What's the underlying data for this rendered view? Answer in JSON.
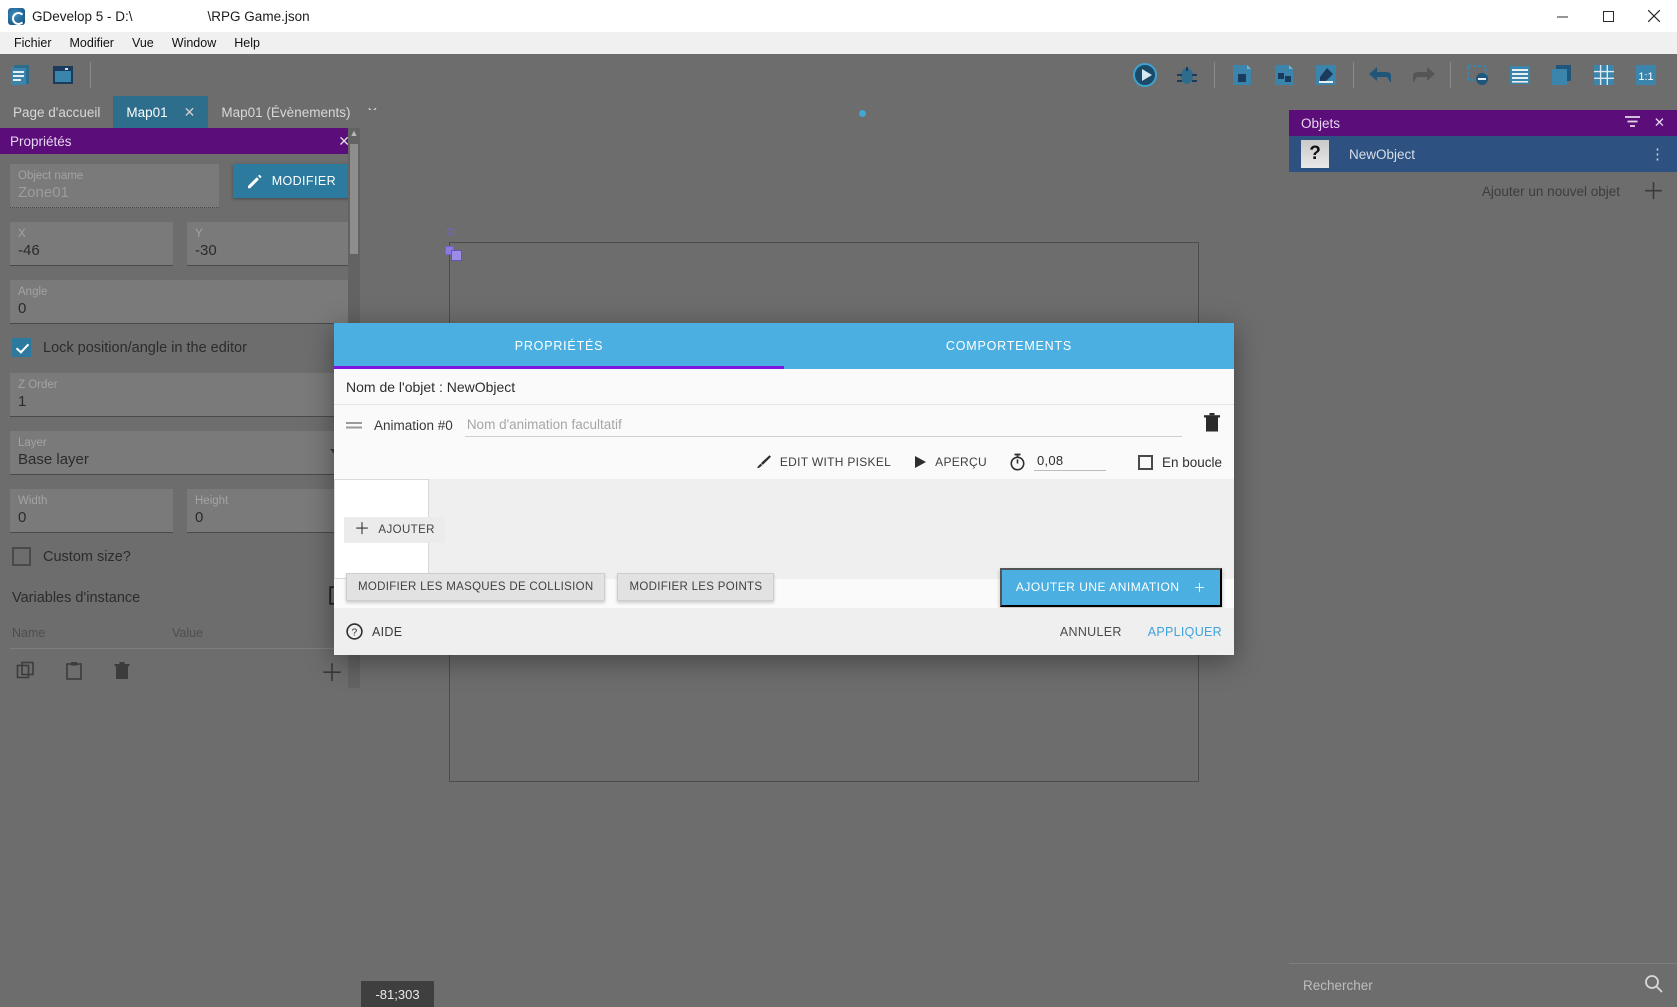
{
  "window": {
    "title": "GDevelop 5 - D:\\                    \\RPG Game.json",
    "minimize": "minimize-icon",
    "maximize": "maximize-icon",
    "close": "close-icon"
  },
  "menubar": {
    "items": [
      {
        "label": "Fichier"
      },
      {
        "label": "Modifier"
      },
      {
        "label": "Vue"
      },
      {
        "label": "Window"
      },
      {
        "label": "Help"
      }
    ]
  },
  "toolbar": {
    "left_icons": [
      "project-manager-icon",
      "scene-editor-icon"
    ],
    "right_icons": [
      "preview-play-icon",
      "debug-bug-icon",
      "new-scene-icon",
      "new-external-layout-icon",
      "open-editor-icon",
      "undo-icon",
      "redo-icon",
      "delete-selection-icon",
      "list-view-icon",
      "layers-icon",
      "grid-icon",
      "zoom-reset-icon"
    ]
  },
  "tabs": [
    {
      "label": "Page d'accueil",
      "active": false,
      "closable": false
    },
    {
      "label": "Map01",
      "active": true,
      "closable": true
    },
    {
      "label": "Map01 (Évènements)",
      "active": false,
      "closable": true
    }
  ],
  "properties_panel": {
    "title": "Propriétés",
    "close_icon": "close-icon",
    "object_name": {
      "label": "Object name",
      "value": "Zone01"
    },
    "modify_button": {
      "label": "MODIFIER",
      "icon": "pencil-icon"
    },
    "x": {
      "label": "X",
      "value": "-46"
    },
    "y": {
      "label": "Y",
      "value": "-30"
    },
    "angle": {
      "label": "Angle",
      "value": "0"
    },
    "lock": {
      "label": "Lock position/angle in the editor",
      "checked": true
    },
    "z_order": {
      "label": "Z Order",
      "value": "1"
    },
    "layer": {
      "label": "Layer",
      "value": "Base layer",
      "icon": "chevron-down-icon"
    },
    "width": {
      "label": "Width",
      "value": "0"
    },
    "height": {
      "label": "Height",
      "value": "0"
    },
    "custom_size": {
      "label": "Custom size?",
      "checked": false
    },
    "variables": {
      "title": "Variables d'instance",
      "open_icon": "external-link-icon",
      "columns": [
        "Name",
        "Value"
      ],
      "toolbar_icons": [
        "copy-icon",
        "paste-icon",
        "trash-icon",
        "add-icon"
      ]
    }
  },
  "canvas": {
    "coordinates": "-81;303"
  },
  "objects_panel": {
    "title": "Objets",
    "filter_icon": "filter-icon",
    "close_icon": "close-icon",
    "items": [
      {
        "name": "NewObject",
        "thumb": "question-mark-icon",
        "menu_icon": "more-vert-icon"
      }
    ],
    "add_label": "Ajouter un nouvel objet",
    "add_icon": "plus-icon",
    "search_placeholder": "Rechercher",
    "search_value": "",
    "search_icon": "search-icon"
  },
  "dialog": {
    "tabs": [
      {
        "label": "PROPRIÉTÉS",
        "active": true
      },
      {
        "label": "COMPORTEMENTS",
        "active": false
      }
    ],
    "object_name_line": "Nom de l'objet : NewObject",
    "animation": {
      "drag_icon": "drag-handle-icon",
      "label": "Animation #0",
      "name_placeholder": "Nom d'animation facultatif",
      "name_value": "",
      "delete_icon": "trash-icon"
    },
    "tools": {
      "edit_with_piskel": {
        "label": "EDIT WITH PISKEL",
        "icon": "brush-icon"
      },
      "preview": {
        "label": "APERÇU",
        "icon": "play-icon"
      },
      "time": {
        "icon": "timer-icon",
        "value": "0,08"
      },
      "loop": {
        "label": "En boucle",
        "checked": false
      }
    },
    "frames": {
      "add_label": "AJOUTER",
      "add_icon": "plus-icon"
    },
    "actions": {
      "edit_collision_masks": "MODIFIER LES MASQUES DE COLLISION",
      "edit_points": "MODIFIER LES POINTS",
      "add_animation": {
        "label": "AJOUTER UNE ANIMATION",
        "icon": "plus-icon"
      }
    },
    "footer": {
      "help": {
        "label": "AIDE",
        "icon": "help-circle-icon"
      },
      "cancel": "ANNULER",
      "apply": "APPLIQUER"
    }
  },
  "colors": {
    "accent_blue": "#4bafe1",
    "panel_purple": "#5b0d79",
    "tab_active": "#2c6e8c",
    "underline_purple": "#7b16e0",
    "chrome_gray": "#6d6d6d"
  }
}
